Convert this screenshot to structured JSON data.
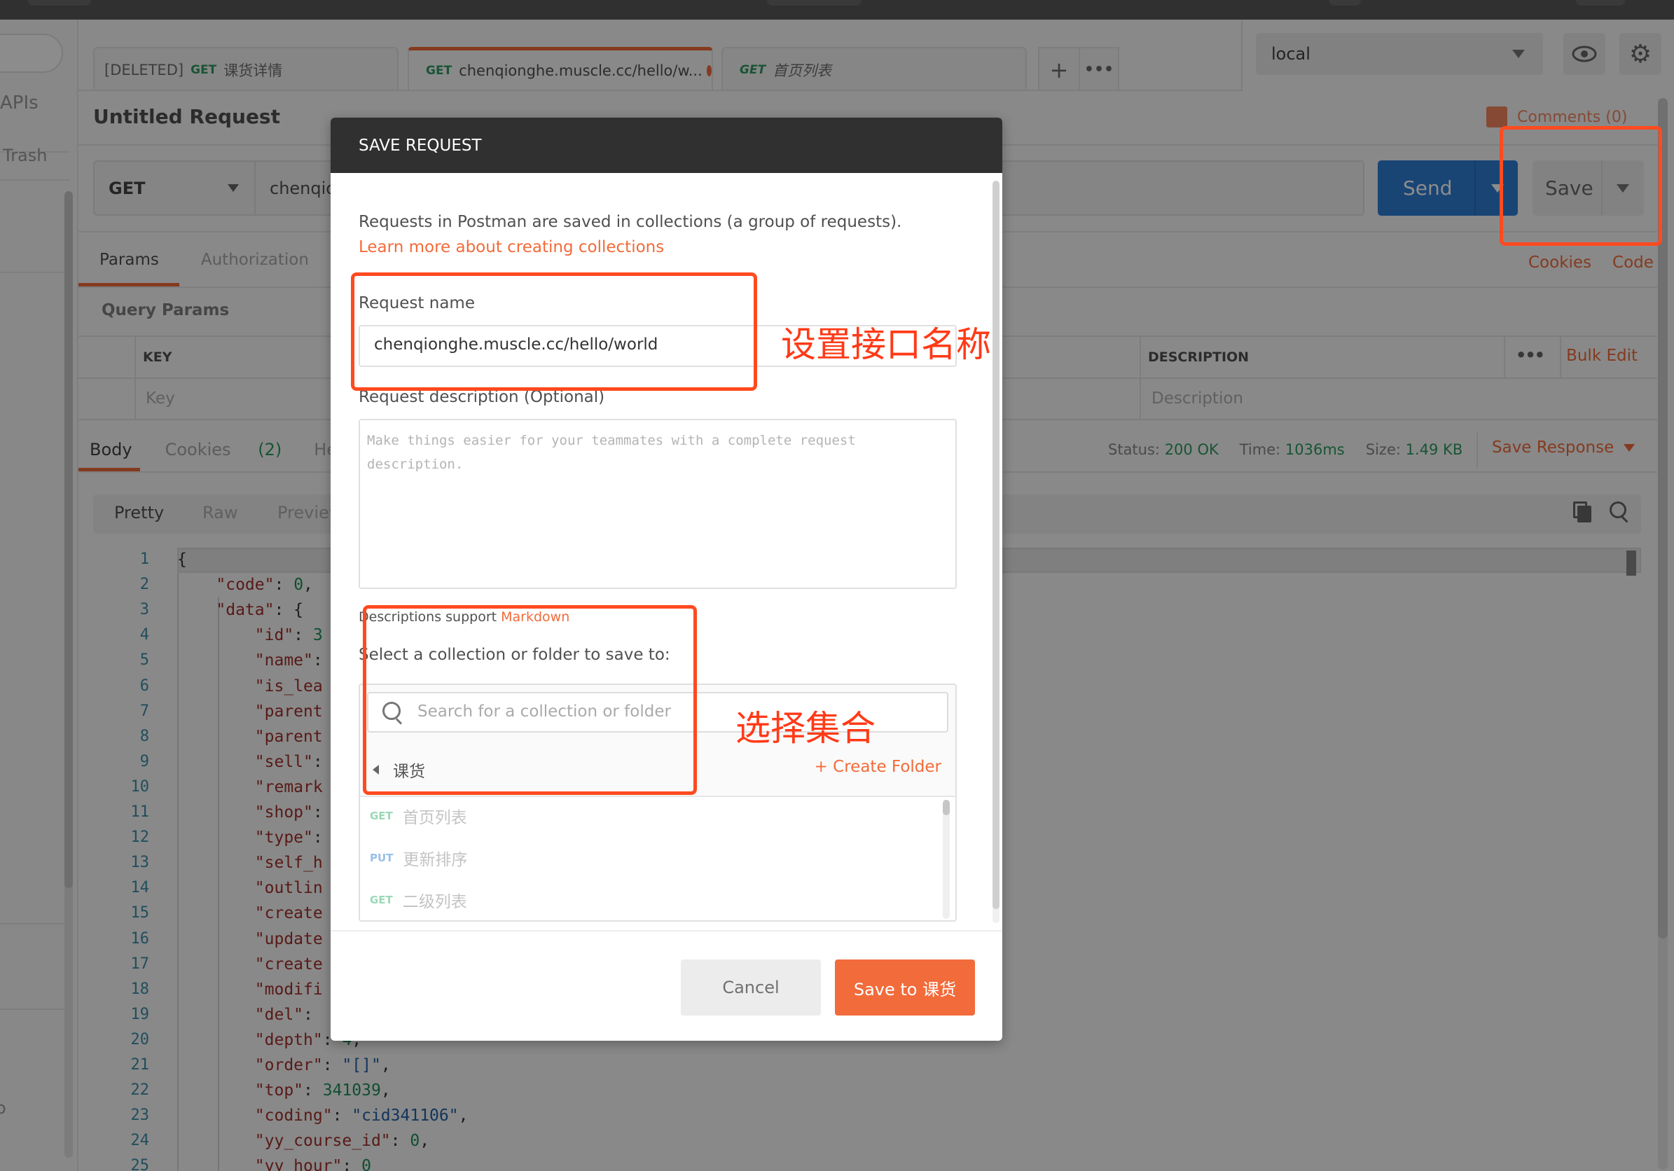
{
  "sidebar": {
    "items": [
      {
        "label": "APIs"
      },
      {
        "label": "Trash"
      }
    ],
    "footer_fragment": "o"
  },
  "tabs": [
    {
      "prefix": "[DELETED]",
      "method": "GET",
      "label": "课货详情",
      "active": false,
      "italic": false
    },
    {
      "prefix": "",
      "method": "GET",
      "label": "chenqionghe.muscle.cc/hello/w...",
      "active": true,
      "unsaved": true,
      "italic": false
    },
    {
      "prefix": "",
      "method": "GET",
      "label": "首页列表",
      "active": false,
      "italic": true
    }
  ],
  "tab_actions": {
    "new_tab": "+",
    "more": "•••"
  },
  "environment": {
    "selected": "local"
  },
  "icons": {
    "eye": "eye-icon",
    "settings": "gear-icon"
  },
  "request": {
    "title": "Untitled Request",
    "comments_label": "Comments (0)",
    "method": "GET",
    "url": "chenqio",
    "send_label": "Send",
    "save_label": "Save",
    "cookies_link": "Cookies",
    "code_link": "Code",
    "tabs": [
      "Params",
      "Authorization"
    ],
    "active_tab": "Params",
    "query_params_title": "Query Params",
    "columns": {
      "key": "KEY",
      "description": "DESCRIPTION"
    },
    "placeholders": {
      "key": "Key",
      "description": "Description"
    },
    "more": "•••",
    "bulk_edit": "Bulk Edit"
  },
  "response": {
    "tabs": [
      {
        "label": "Body",
        "active": true
      },
      {
        "label": "Cookies",
        "badge": "(2)"
      },
      {
        "label": "Headers"
      }
    ],
    "status_label": "Status:",
    "status_value": "200 OK",
    "time_label": "Time:",
    "time_value": "1036ms",
    "size_label": "Size:",
    "size_value": "1.49 KB",
    "save_response": "Save Response",
    "views": [
      "Pretty",
      "Raw",
      "Preview"
    ],
    "active_view": "Pretty",
    "code_lines": [
      {
        "n": "1",
        "indent": 0,
        "key": "",
        "rest": "{",
        "type": "p"
      },
      {
        "n": "2",
        "indent": 1,
        "key": "\"code\"",
        "rest": ": ",
        "val": "0",
        "vtype": "n",
        "tail": ","
      },
      {
        "n": "3",
        "indent": 1,
        "key": "\"data\"",
        "rest": ": {",
        "val": "",
        "vtype": "",
        "tail": ""
      },
      {
        "n": "4",
        "indent": 2,
        "key": "\"id\"",
        "rest": ": ",
        "val": "3",
        "vtype": "n",
        "tail": ""
      },
      {
        "n": "5",
        "indent": 2,
        "key": "\"name\"",
        "rest": ":",
        "val": "",
        "vtype": "",
        "tail": ""
      },
      {
        "n": "6",
        "indent": 2,
        "key": "\"is_lea",
        "rest": "",
        "val": "",
        "vtype": "",
        "tail": ""
      },
      {
        "n": "7",
        "indent": 2,
        "key": "\"parent",
        "rest": "",
        "val": "",
        "vtype": "",
        "tail": ""
      },
      {
        "n": "8",
        "indent": 2,
        "key": "\"parent",
        "rest": "",
        "val": "",
        "vtype": "",
        "tail": ""
      },
      {
        "n": "9",
        "indent": 2,
        "key": "\"sell\"",
        "rest": ":",
        "val": "",
        "vtype": "",
        "tail": ""
      },
      {
        "n": "10",
        "indent": 2,
        "key": "\"remark",
        "rest": "",
        "val": "",
        "vtype": "",
        "tail": ""
      },
      {
        "n": "11",
        "indent": 2,
        "key": "\"shop\"",
        "rest": ":",
        "val": "",
        "vtype": "",
        "tail": ""
      },
      {
        "n": "12",
        "indent": 2,
        "key": "\"type\"",
        "rest": ":",
        "val": "",
        "vtype": "",
        "tail": ""
      },
      {
        "n": "13",
        "indent": 2,
        "key": "\"self_h",
        "rest": "",
        "val": "",
        "vtype": "",
        "tail": ""
      },
      {
        "n": "14",
        "indent": 2,
        "key": "\"outlin",
        "rest": "",
        "val": "",
        "vtype": "",
        "tail": ""
      },
      {
        "n": "15",
        "indent": 2,
        "key": "\"create",
        "rest": "",
        "val": "",
        "vtype": "",
        "tail": ""
      },
      {
        "n": "16",
        "indent": 2,
        "key": "\"update",
        "rest": "",
        "val": "",
        "vtype": "",
        "tail": ""
      },
      {
        "n": "17",
        "indent": 2,
        "key": "\"create",
        "rest": "",
        "val": "",
        "vtype": "",
        "tail": ""
      },
      {
        "n": "18",
        "indent": 2,
        "key": "\"modifi",
        "rest": "",
        "val": "",
        "vtype": "",
        "tail": ""
      },
      {
        "n": "19",
        "indent": 2,
        "key": "\"del\"",
        "rest": ":",
        "val": "",
        "vtype": "",
        "tail": ""
      },
      {
        "n": "20",
        "indent": 2,
        "key": "\"depth\"",
        "rest": ": ",
        "val": "4",
        "vtype": "n",
        "tail": ","
      },
      {
        "n": "21",
        "indent": 2,
        "key": "\"order\"",
        "rest": ": ",
        "val": "\"[]\"",
        "vtype": "s",
        "tail": ","
      },
      {
        "n": "22",
        "indent": 2,
        "key": "\"top\"",
        "rest": ": ",
        "val": "341039",
        "vtype": "n",
        "tail": ","
      },
      {
        "n": "23",
        "indent": 2,
        "key": "\"coding\"",
        "rest": ": ",
        "val": "\"cid341106\"",
        "vtype": "s",
        "tail": ","
      },
      {
        "n": "24",
        "indent": 2,
        "key": "\"yy_course_id\"",
        "rest": ": ",
        "val": "0",
        "vtype": "n",
        "tail": ","
      },
      {
        "n": "25",
        "indent": 2,
        "key": "\"yy_hour\"",
        "rest": ": ",
        "val": "0",
        "vtype": "n",
        "tail": ""
      }
    ]
  },
  "modal": {
    "title": "SAVE REQUEST",
    "intro": "Requests in Postman are saved in collections (a group of requests).",
    "learn_more": "Learn more about creating collections",
    "name_label": "Request name",
    "name_value": "chenqionghe.muscle.cc/hello/world",
    "description_label": "Request description (Optional)",
    "description_placeholder": "Make things easier for your teammates with a complete request description.",
    "markdown_prefix": "Descriptions support ",
    "markdown_link": "Markdown",
    "select_label": "Select a collection or folder to save to:",
    "search_placeholder": "Search for a collection or folder",
    "current_collection": "课货",
    "create_folder": "+ Create Folder",
    "items": [
      {
        "method": "GET",
        "name": "首页列表"
      },
      {
        "method": "PUT",
        "name": "更新排序"
      },
      {
        "method": "GET",
        "name": "二级列表"
      }
    ],
    "cancel": "Cancel",
    "save_to": "Save to 课货"
  },
  "annotations": {
    "name_note": "设置接口名称",
    "collection_note": "选择集合"
  },
  "colors": {
    "accent": "#f26b3a",
    "send": "#2f7fd6",
    "success": "#2e9a61",
    "annotation": "#ff4a1f"
  }
}
